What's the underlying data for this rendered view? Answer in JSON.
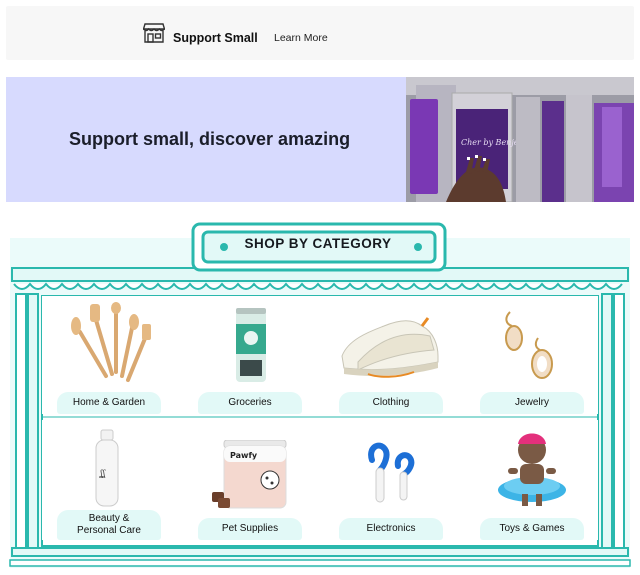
{
  "topbar": {
    "brand_label": "Support Small",
    "learn_more": "Learn More",
    "icon": "storefront-icon"
  },
  "hero": {
    "title": "Support small, discover amazing",
    "photo_text": "Cher by Benje"
  },
  "section": {
    "title": "SHOP BY CATEGORY"
  },
  "categories": [
    {
      "label": "Home & Garden",
      "icon": "wooden-utensils"
    },
    {
      "label": "Groceries",
      "icon": "beverage-can"
    },
    {
      "label": "Clothing",
      "icon": "sneakers"
    },
    {
      "label": "Jewelry",
      "icon": "earrings"
    },
    {
      "label_line1": "Beauty &",
      "label_line2": "Personal Care",
      "icon": "beauty-bottle"
    },
    {
      "label": "Pet Supplies",
      "icon": "pet-supplement-tub",
      "product_brand": "Pawfy"
    },
    {
      "label": "Electronics",
      "icon": "earbud-hooks"
    },
    {
      "label": "Toys & Games",
      "icon": "doll"
    }
  ],
  "colors": {
    "teal": "#2ab8ad",
    "mint": "#e2f9f7",
    "hero_bg": "#d7dafe"
  }
}
